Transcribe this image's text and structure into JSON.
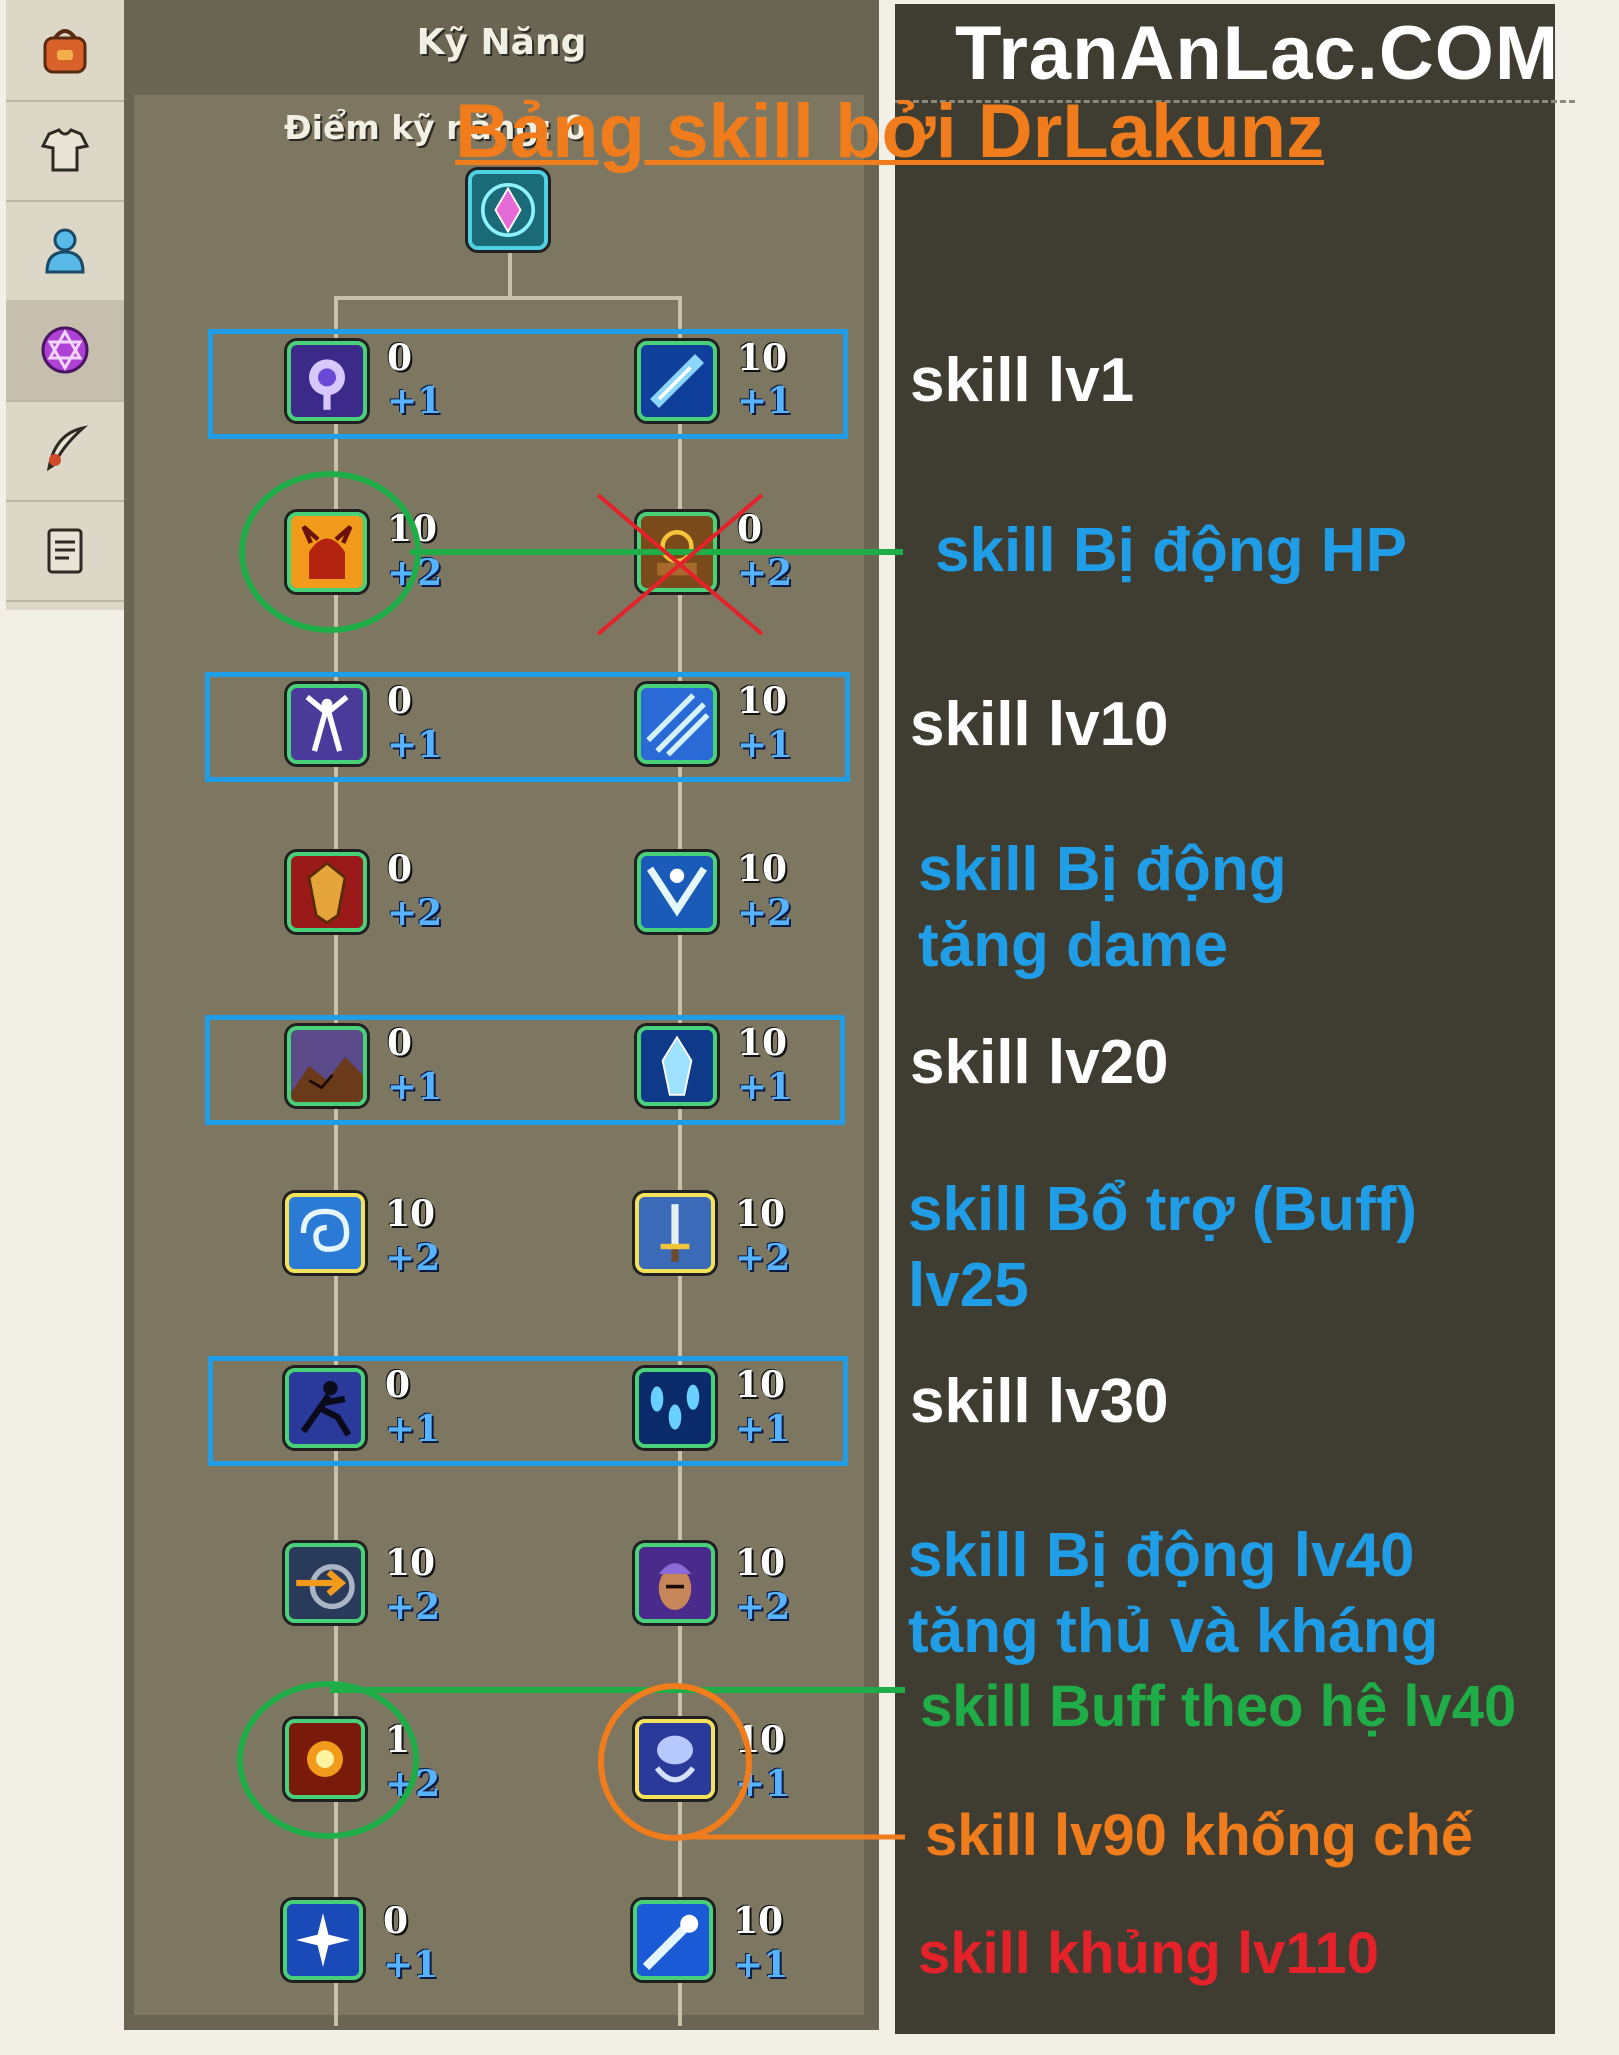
{
  "window": {
    "title": "Kỹ Năng",
    "points_label": "Điểm kỹ năng: 0"
  },
  "tabs": [
    {
      "name": "bag-icon"
    },
    {
      "name": "armor-icon"
    },
    {
      "name": "character-icon"
    },
    {
      "name": "skill-star-icon",
      "active": true
    },
    {
      "name": "quill-icon"
    },
    {
      "name": "quest-scroll-icon"
    }
  ],
  "watermark": {
    "site": "TranAnLac.COM",
    "credit": "Bảng skill bởi DrLakunz"
  },
  "skill_rows": [
    {
      "left": {
        "level": "0",
        "increment": "+1",
        "icon": "orb-icon"
      },
      "right": {
        "level": "10",
        "increment": "+1",
        "icon": "ice-shard-icon"
      }
    },
    {
      "left": {
        "level": "10",
        "increment": "+2",
        "icon": "demon-icon"
      },
      "right": {
        "level": "0",
        "increment": "+2",
        "icon": "rune-icon"
      }
    },
    {
      "left": {
        "level": "0",
        "increment": "+1",
        "icon": "spirit-icon"
      },
      "right": {
        "level": "10",
        "increment": "+1",
        "icon": "frost-slash-icon"
      }
    },
    {
      "left": {
        "level": "0",
        "increment": "+2",
        "icon": "shield-icon"
      },
      "right": {
        "level": "10",
        "increment": "+2",
        "icon": "ice-burst-icon"
      }
    },
    {
      "left": {
        "level": "0",
        "increment": "+1",
        "icon": "earth-crack-icon"
      },
      "right": {
        "level": "10",
        "increment": "+1",
        "icon": "ice-crystal-icon"
      }
    },
    {
      "left": {
        "level": "10",
        "increment": "+2",
        "icon": "whirlwind-icon"
      },
      "right": {
        "level": "10",
        "increment": "+2",
        "icon": "sword-icon"
      }
    },
    {
      "left": {
        "level": "0",
        "increment": "+1",
        "icon": "ninja-icon"
      },
      "right": {
        "level": "10",
        "increment": "+1",
        "icon": "ice-rain-icon"
      }
    },
    {
      "left": {
        "level": "10",
        "increment": "+2",
        "icon": "arrow-strike-icon"
      },
      "right": {
        "level": "10",
        "increment": "+2",
        "icon": "warrior-icon"
      }
    },
    {
      "left": {
        "level": "1",
        "increment": "+2",
        "icon": "fire-blast-icon"
      },
      "right": {
        "level": "10",
        "increment": "+1",
        "icon": "chain-icon"
      }
    },
    {
      "left": {
        "level": "0",
        "increment": "+1",
        "icon": "star-burst-icon"
      },
      "right": {
        "level": "10",
        "increment": "+1",
        "icon": "ice-comet-icon"
      }
    }
  ],
  "annotations": [
    {
      "text": "skill lv1",
      "color": "#ffffff"
    },
    {
      "text": "skill Bị động HP",
      "color": "#1f9ee7"
    },
    {
      "text": "skill lv10",
      "color": "#ffffff"
    },
    {
      "text": "skill Bị động\ntăng dame",
      "color": "#1f9ee7"
    },
    {
      "text": "skill lv20",
      "color": "#ffffff"
    },
    {
      "text": "skill Bổ trợ (Buff)\nlv25",
      "color": "#1f9ee7"
    },
    {
      "text": "skill lv30",
      "color": "#ffffff"
    },
    {
      "text": "skill Bị động lv40\ntăng thủ và kháng",
      "color": "#1f9ee7"
    },
    {
      "text": "skill Buff theo hệ lv40",
      "color": "#1ead46"
    },
    {
      "text": "skill lv90 khống chế",
      "color": "#f07c1c"
    },
    {
      "text": "skill khủng lv110",
      "color": "#e5212a"
    }
  ]
}
